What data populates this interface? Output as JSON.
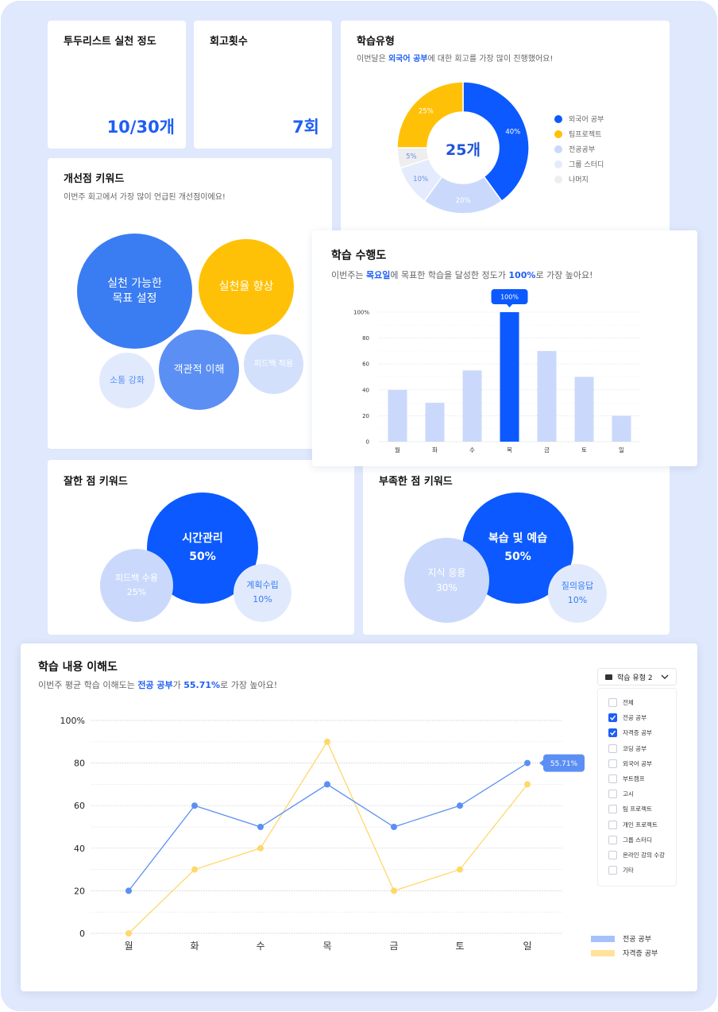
{
  "todo": {
    "title": "투두리스트 실천 정도",
    "value": "10/30개"
  },
  "retro": {
    "title": "회고횟수",
    "value": "7회"
  },
  "study_type": {
    "title": "학습유형",
    "sub_pre": "이번달은 ",
    "sub_em": "외국어 공부",
    "sub_post": "에 대한 회고를 가장 많이 진행했어요!",
    "center": "25개",
    "legend": [
      "외국어 공부",
      "팀프로젝트",
      "전공공부",
      "그룹 스터디",
      "나머지"
    ],
    "colors": [
      "#0b59ff",
      "#ffc107",
      "#cad9fb",
      "#e3ebfc",
      "#eeeeee"
    ]
  },
  "improve": {
    "title": "개선점 키워드",
    "sub": "이번주 회고에서 가장 많이 언급된 개선점이에요!",
    "bubbles": [
      "실천 가능한",
      "목표 설정",
      "실천율 향상",
      "객관적 이해",
      "소통 강화",
      "피드백 적용"
    ]
  },
  "perf": {
    "title": "학습 수행도",
    "sub_pre": "이번주는 ",
    "sub_em1": "목요일",
    "sub_mid": "에 목표한 학습을 달성한 정도가 ",
    "sub_em2": "100%",
    "sub_post": "로 가장 높아요!",
    "tooltip": "100%"
  },
  "good": {
    "title": "잘한 점 키워드",
    "b1": "시간관리",
    "b1v": "50%",
    "b2": "피드백 수용",
    "b2v": "25%",
    "b3": "계획수립",
    "b3v": "10%"
  },
  "lack": {
    "title": "부족한 점 키워드",
    "b1": "복습 및 예습",
    "b1v": "50%",
    "b2": "지식 응용",
    "b2v": "30%",
    "b3": "질의응답",
    "b3v": "10%"
  },
  "understand": {
    "title": "학습 내용 이해도",
    "sub_pre": "이번주 평균 학습 이해도는 ",
    "sub_em1": "전공 공부",
    "sub_mid": "가 ",
    "sub_em2": "55.71%",
    "sub_post": "로 가장 높아요!",
    "dropdown": "학습 유형 2",
    "options": [
      "전체",
      "전공 공부",
      "자격증 공부",
      "코딩 공부",
      "외국어 공부",
      "부트캠프",
      "고시",
      "팀 프로젝트",
      "개인 프로젝트",
      "그룹 스터디",
      "온라인 강의 수강",
      "기타"
    ],
    "checked": [
      false,
      true,
      true,
      false,
      false,
      false,
      false,
      false,
      false,
      false,
      false,
      false
    ],
    "tooltip": "55.71%"
  },
  "chart_data": [
    {
      "type": "pie",
      "title": "학습유형",
      "categories": [
        "외국어 공부",
        "전공공부",
        "그룹 스터디",
        "나머지",
        "팀프로젝트"
      ],
      "values": [
        40,
        20,
        10,
        5,
        25
      ],
      "labels": [
        "40%",
        "20%",
        "10%",
        "5%",
        "25%"
      ],
      "colors": [
        "#0b59ff",
        "#cad9fb",
        "#e3ebfc",
        "#eeeeee",
        "#ffc107"
      ]
    },
    {
      "type": "bar",
      "title": "학습 수행도",
      "categories": [
        "월",
        "화",
        "수",
        "목",
        "금",
        "토",
        "일"
      ],
      "values": [
        40,
        30,
        55,
        100,
        70,
        50,
        20
      ],
      "ylim": [
        0,
        100
      ],
      "yticks": [
        "0",
        "20",
        "40",
        "60",
        "80",
        "100%"
      ],
      "highlight_color": "#0b59ff",
      "bar_color": "#cad9fb"
    },
    {
      "type": "line",
      "title": "학습 내용 이해도",
      "categories": [
        "월",
        "화",
        "수",
        "목",
        "금",
        "토",
        "일"
      ],
      "ylim": [
        0,
        100
      ],
      "yticks": [
        "0",
        "20",
        "40",
        "60",
        "80",
        "100%"
      ],
      "series": [
        {
          "name": "전공 공부",
          "values": [
            20,
            60,
            50,
            70,
            50,
            60,
            80
          ],
          "color": "#5b8ff4"
        },
        {
          "name": "자격증 공부",
          "values": [
            0,
            30,
            40,
            90,
            20,
            30,
            70
          ],
          "color": "#ffd86b"
        }
      ]
    }
  ]
}
